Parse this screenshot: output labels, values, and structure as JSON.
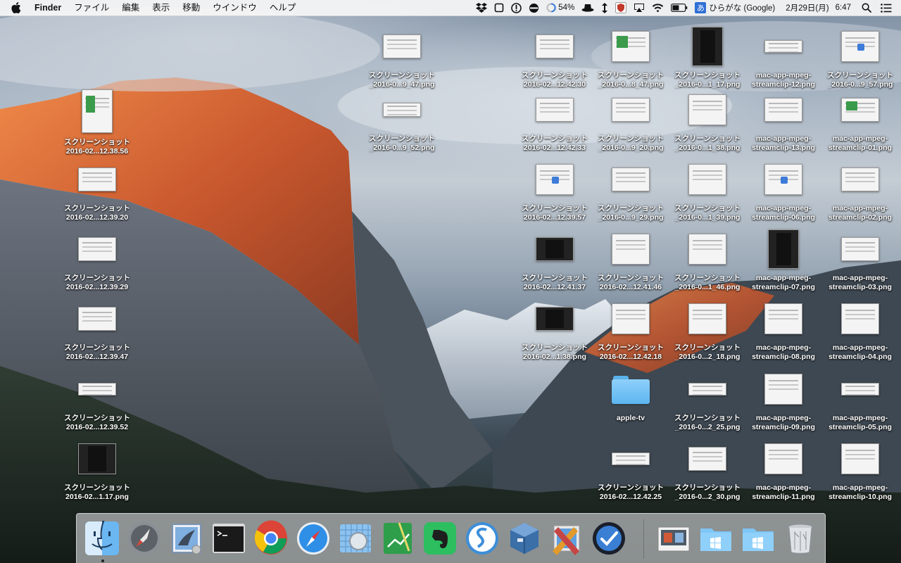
{
  "menubar": {
    "app_name": "Finder",
    "menus": [
      "ファイル",
      "編集",
      "表示",
      "移動",
      "ウインドウ",
      "ヘルプ"
    ],
    "status": {
      "battery_icon_value": "54%",
      "ime_badge": "あ",
      "ime_label": "ひらがな (Google)",
      "date": "2月29日(月)",
      "time": "6:47"
    },
    "icons": [
      "apple-logo-icon",
      "dropbox-icon",
      "square-icon",
      "info-circle-icon",
      "sync-icon",
      "progress-ring-icon",
      "hat-icon",
      "updown-arrow-icon",
      "shield-icon",
      "airplay-icon",
      "wifi-icon",
      "battery-icon",
      "input-method-icon",
      "spotlight-icon",
      "notification-center-icon"
    ]
  },
  "desktop": {
    "icons": [
      {
        "label": "スクリーンショット\n_2016-0...9_47.png",
        "kind": "screenshot"
      },
      {
        "label": "スクリーンショット\n2016-02...12.42.30",
        "kind": "screenshot"
      },
      {
        "label": "スクリーンショット\n_2016-0...8_47.png",
        "kind": "screenshot"
      },
      {
        "label": "スクリーンショット\n_2016-0...1_17.png",
        "kind": "screenshot"
      },
      {
        "label": "mac-app-mpeg-\nstreamclip-12.png",
        "kind": "screenshot"
      },
      {
        "label": "スクリーンショット\n_2016-0...9_57.png",
        "kind": "screenshot"
      },
      {
        "label": "スクリーンショット\n2016-02...12.38.56",
        "kind": "screenshot"
      },
      {
        "label": "スクリーンショット\n_2016-0...9_52.png",
        "kind": "screenshot"
      },
      {
        "label": "スクリーンショット\n2016-02...12.42.33",
        "kind": "screenshot"
      },
      {
        "label": "スクリーンショット\n_2016-0...9_20.png",
        "kind": "screenshot"
      },
      {
        "label": "スクリーンショット\n_2016-0...1_38.png",
        "kind": "screenshot"
      },
      {
        "label": "mac-app-mpeg-\nstreamclip-13.png",
        "kind": "screenshot"
      },
      {
        "label": "mac-app-mpeg-\nstreamclip-01.png",
        "kind": "screenshot"
      },
      {
        "label": "スクリーンショット\n2016-02...12.39.20",
        "kind": "screenshot"
      },
      {
        "label": "スクリーンショット\n2016-02...12.39.57",
        "kind": "screenshot"
      },
      {
        "label": "スクリーンショット\n_2016-0...9_29.png",
        "kind": "screenshot"
      },
      {
        "label": "スクリーンショット\n_2016-0...1_39.png",
        "kind": "screenshot"
      },
      {
        "label": "mac-app-mpeg-\nstreamclip-06.png",
        "kind": "screenshot"
      },
      {
        "label": "mac-app-mpeg-\nstreamclip-02.png",
        "kind": "screenshot"
      },
      {
        "label": "スクリーンショット\n2016-02...12.39.29",
        "kind": "screenshot"
      },
      {
        "label": "スクリーンショット\n2016-02...12.41.37",
        "kind": "screenshot"
      },
      {
        "label": "スクリーンショット\n2016-02...12.41.46",
        "kind": "screenshot"
      },
      {
        "label": "スクリーンショット\n_2016-0...1_46.png",
        "kind": "screenshot"
      },
      {
        "label": "mac-app-mpeg-\nstreamclip-07.png",
        "kind": "screenshot"
      },
      {
        "label": "mac-app-mpeg-\nstreamclip-03.png",
        "kind": "screenshot"
      },
      {
        "label": "スクリーンショット\n2016-02...12.39.47",
        "kind": "screenshot"
      },
      {
        "label": "スクリーンショット\n2016-02...1.38.png",
        "kind": "screenshot"
      },
      {
        "label": "スクリーンショット\n2016-02...12.42.18",
        "kind": "screenshot"
      },
      {
        "label": "スクリーンショット\n_2016-0...2_18.png",
        "kind": "screenshot"
      },
      {
        "label": "mac-app-mpeg-\nstreamclip-08.png",
        "kind": "screenshot"
      },
      {
        "label": "mac-app-mpeg-\nstreamclip-04.png",
        "kind": "screenshot"
      },
      {
        "label": "スクリーンショット\n2016-02...12.39.52",
        "kind": "screenshot"
      },
      {
        "label": "apple-tv",
        "kind": "folder"
      },
      {
        "label": "スクリーンショット\n_2016-0...2_25.png",
        "kind": "screenshot"
      },
      {
        "label": "mac-app-mpeg-\nstreamclip-09.png",
        "kind": "screenshot"
      },
      {
        "label": "mac-app-mpeg-\nstreamclip-05.png",
        "kind": "screenshot"
      },
      {
        "label": "スクリーンショット\n2016-02...1.17.png",
        "kind": "screenshot"
      },
      {
        "label": "スクリーンショット\n2016-02...12.42.25",
        "kind": "screenshot"
      },
      {
        "label": "スクリーンショット\n_2016-0...2_30.png",
        "kind": "screenshot"
      },
      {
        "label": "mac-app-mpeg-\nstreamclip-11.png",
        "kind": "screenshot"
      },
      {
        "label": "mac-app-mpeg-\nstreamclip-10.png",
        "kind": "screenshot"
      }
    ]
  },
  "dock": {
    "apps": [
      "finder-icon",
      "launchpad-icon",
      "mail-icon",
      "terminal-icon",
      "chrome-icon",
      "safari-icon",
      "preview-icon",
      "numbers-icon",
      "evernote-icon",
      "simplenote-icon",
      "virtualbox-icon",
      "pixelmator-icon",
      "omnifocus-icon"
    ],
    "others": [
      "screenshot-stack-icon",
      "folder-stack-icon",
      "downloads-stack-icon",
      "trash-icon"
    ]
  }
}
